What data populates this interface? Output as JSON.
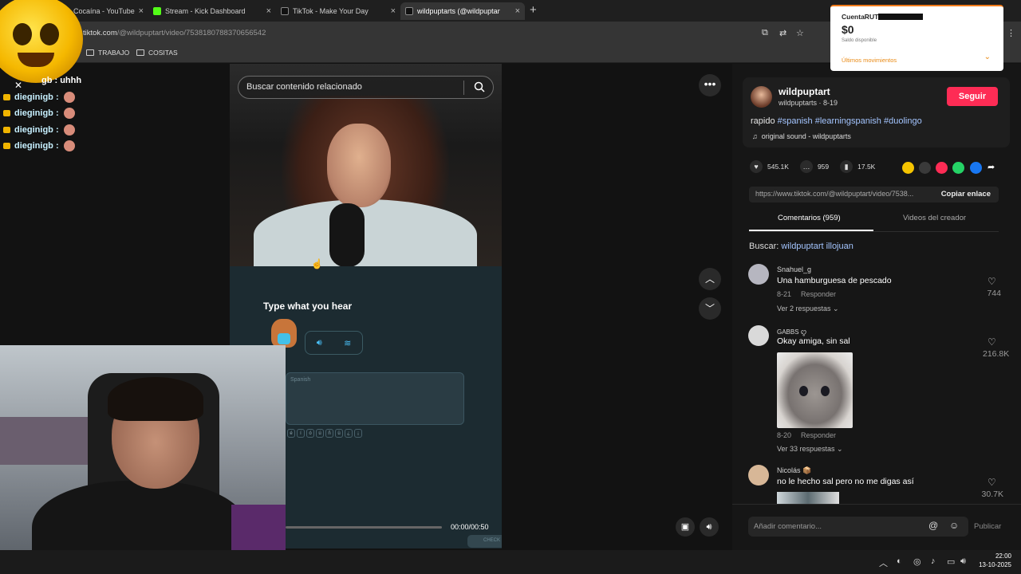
{
  "browser": {
    "tabs": [
      {
        "label": "Cocaína - YouTube",
        "active": false
      },
      {
        "label": "Stream - Kick Dashboard",
        "active": false
      },
      {
        "label": "TikTok - Make Your Day",
        "active": false
      },
      {
        "label": "wildpuptarts (@wildpuptart",
        "active": true
      }
    ],
    "url_host": "tiktok.com",
    "url_path": "/@wildpuptart/video/7538180788370656542",
    "bookmarks": [
      "TRABAJO",
      "COSITAS"
    ]
  },
  "chat": {
    "first_line": "gb : uhhh",
    "lines": [
      {
        "name": "dieginigb :"
      },
      {
        "name": "dieginigb :"
      },
      {
        "name": "dieginigb :"
      },
      {
        "name": "dieginigb :"
      }
    ]
  },
  "wallet": {
    "title": "CuentaRUT",
    "amount": "$0",
    "saldo": "Saldo disponible",
    "movements": "Últimos movimientos"
  },
  "video": {
    "search_placeholder": "Buscar contenido relacionado",
    "prompt": "Type what you hear",
    "answer_placeholder": "Spanish",
    "time": "00:00/00:50",
    "check": "CHECK"
  },
  "author": {
    "name": "wildpuptart",
    "sub": "wildpuptarts · 8-19",
    "follow": "Seguir",
    "caption_prefix": "rapido ",
    "tags": [
      "#spanish",
      "#learningspanish",
      "#duolingo"
    ],
    "sound": "original sound - wildpuptarts"
  },
  "stats": {
    "likes": "545.1K",
    "comments": "959",
    "saves": "17.5K"
  },
  "link": {
    "url": "https://www.tiktok.com/@wildpuptart/video/7538...",
    "copy": "Copiar enlace"
  },
  "tabs": {
    "comments": "Comentarios (959)",
    "videos": "Videos del creador"
  },
  "search_suggest": {
    "label": "Buscar:",
    "query": "wildpuptart illojuan"
  },
  "comments": [
    {
      "user": "Snahuel_g",
      "text": "Una hamburguesa de pescado",
      "date": "8-21",
      "reply": "Responder",
      "more": "Ver 2 respuestas",
      "likes": "744"
    },
    {
      "user": "GABBS ꨄ",
      "text": "Okay amiga, sin sal",
      "date": "8-20",
      "reply": "Responder",
      "more": "Ver 33 respuestas",
      "likes": "216.8K"
    },
    {
      "user": "Nicolás 📦",
      "text": "no le hecho sal pero no me digas así",
      "likes": "30.7K"
    }
  ],
  "composer": {
    "placeholder": "Añadir comentario...",
    "publish": "Publicar"
  },
  "taskbar": {
    "time": "22:00",
    "date": "13-10-2025"
  },
  "colors": {
    "follow": "#fe2c55",
    "hashtag": "#a4c5ff",
    "wallet_accent": "#f27b1a"
  }
}
